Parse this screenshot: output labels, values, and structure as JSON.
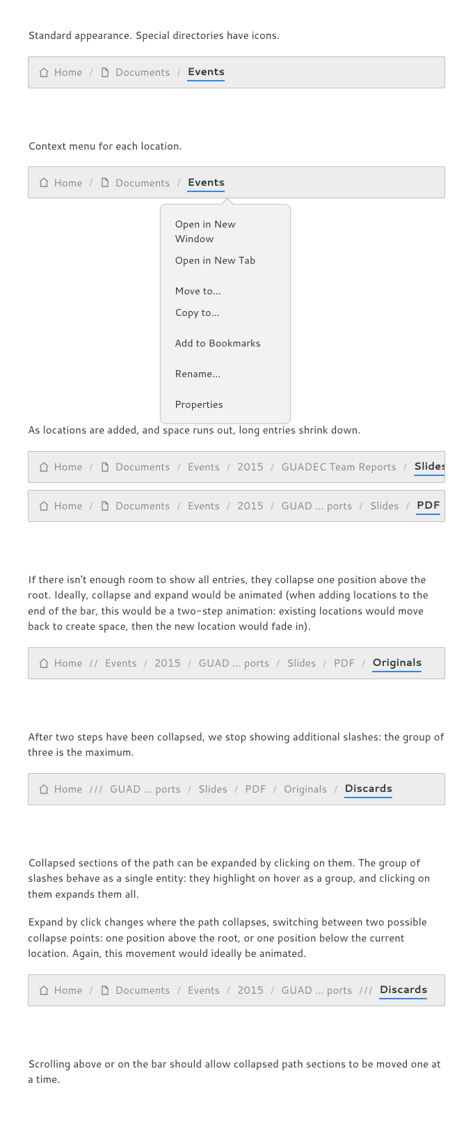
{
  "sections": {
    "s1_desc": "Standard appearance. Special directories have icons.",
    "s2_desc": "Context menu for each location.",
    "s3_desc": "As locations are added, and space runs out, long entries shrink down.",
    "s4_desc": "If there isn't enough room to show all entries, they collapse one position above the root. Ideally, collapse and expand would be animated (when adding locations to the end of the bar, this would be a two-step animation: existing locations would move back to create space, then the new location would fade in).",
    "s5_desc": "After two steps have been collapsed, we stop showing additional slashes: the group of three is the maximum.",
    "s6a_desc": "Collapsed sections of the path can be expanded by clicking on them. The group of slashes behave as a single entity: they highlight on hover as a group, and clicking on them expands them all.",
    "s6b_desc": "Expand by click changes where the path collapses, switching between two possible collapse points: one position above the root, or one position below the current location. Again, this movement would ideally be animated.",
    "s7_desc": "Scrolling above or on the bar should allow collapsed path sections to be moved one at a time."
  },
  "crumbs": {
    "home": "Home",
    "documents": "Documents",
    "events": "Events",
    "y2015": "2015",
    "guadec_full": "GUADEC Team Reports",
    "guadec_short": "GUAD … ports",
    "slides": "Slides",
    "pdf": "PDF",
    "originals": "Originals",
    "discards": "Discards"
  },
  "menu": {
    "open_new_window": "Open in New Window",
    "open_new_tab": "Open in New Tab",
    "move_to": "Move to…",
    "copy_to": "Copy to…",
    "add_bookmarks": "Add to Bookmarks",
    "rename": "Rename…",
    "properties": "Properties"
  }
}
